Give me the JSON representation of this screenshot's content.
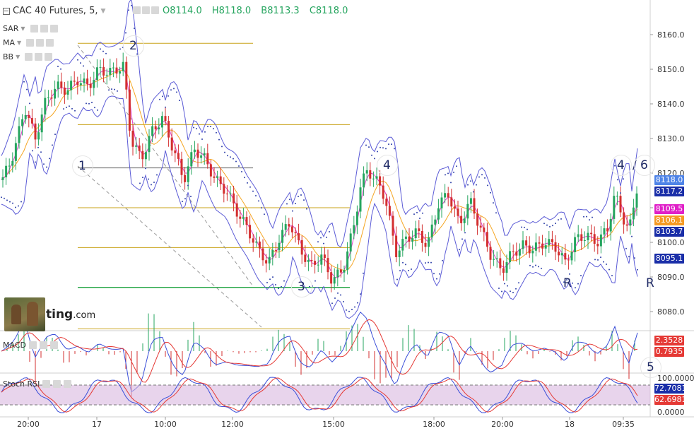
{
  "header": {
    "symbol": "CAC 40 Futures, 5,",
    "open": "O8114.0",
    "high": "H8118.0",
    "low": "B8113.3",
    "close": "C8118.0"
  },
  "indicators": [
    {
      "label": "SAR"
    },
    {
      "label": "MA"
    },
    {
      "label": "BB"
    }
  ],
  "logo": {
    "text": "ting",
    "suffix": ".com"
  },
  "colors": {
    "up": "#26a55f",
    "down": "#d32f2f",
    "bb": "#5b5bd6",
    "ma_fast": "#e040c8",
    "ma_slow": "#f5a623",
    "fib": "#c9a31a",
    "fib_main": "#2aa84a",
    "sar": "#3344aa",
    "macd": "#3b4fd8",
    "signal": "#e53935",
    "rsi_k": "#3b4fd8",
    "rsi_d": "#e53935",
    "rsi_band": "#d9b8e0"
  },
  "chart_data": {
    "type": "candlestick",
    "price_axis": {
      "ticks": [
        "8160.0",
        "8150.0",
        "8140.0",
        "8130.0",
        "8120.0",
        "8110.0",
        "8100.0",
        "8090.0",
        "8080.0"
      ]
    },
    "time_axis": {
      "ticks": [
        "20:00",
        "17",
        "10:00",
        "12:00",
        "15:00",
        "18:00",
        "20:00",
        "18",
        "09:35"
      ]
    },
    "price_tags": [
      {
        "value": "8118.0",
        "color": "#4f84e8"
      },
      {
        "value": "8117.2",
        "color": "#1a2ea8"
      },
      {
        "value": "8109.5",
        "color": "#e020c8"
      },
      {
        "value": "8106.1",
        "color": "#f59a23"
      },
      {
        "value": "8103.7",
        "color": "#1a2ea8"
      },
      {
        "value": "8095.1",
        "color": "#1a2ea8"
      }
    ],
    "fib_levels": [
      8157.5,
      8134.0,
      8121.5,
      8110.0,
      8098.5,
      8087.0,
      8075.0
    ],
    "wave_labels": [
      "1",
      "2",
      "3",
      "4",
      "4",
      "/",
      "6",
      "5",
      "R",
      "R"
    ],
    "macd": {
      "label": "MACD",
      "values": [
        "2.3528",
        "0.7935"
      ]
    },
    "stoch_rsi": {
      "label": "Stoch RSI",
      "axis_top": "100.0000",
      "axis_bottom": "0.0000",
      "values": [
        "72.7081",
        "62.6981"
      ]
    }
  }
}
